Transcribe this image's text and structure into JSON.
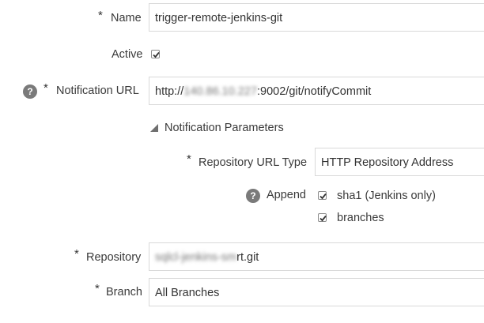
{
  "form": {
    "name": {
      "label": "Name",
      "required_mark": "*",
      "value": "trigger-remote-jenkins-git"
    },
    "active": {
      "label": "Active",
      "checked": true
    },
    "notification_url": {
      "label": "Notification URL",
      "required_mark": "*",
      "value_obscured": "140.86.10.227",
      "value_tail": ":9002/git/notifyCommit",
      "value_prefix": "http://",
      "help_icon": "question-circle-icon",
      "help_glyph": "?"
    },
    "notification_parameters": {
      "label": "Notification Parameters",
      "expander_icon": "triangle-down-icon"
    },
    "repository_url_type": {
      "label": "Repository URL Type",
      "required_mark": "*",
      "value": "HTTP Repository Address"
    },
    "append": {
      "label": "Append",
      "help_icon": "question-circle-icon",
      "help_glyph": "?",
      "options": [
        {
          "label": "sha1 (Jenkins only)",
          "checked": true
        },
        {
          "label": "branches",
          "checked": true
        }
      ]
    },
    "repository": {
      "label": "Repository",
      "required_mark": "*",
      "value_obscured": "sqlcl-jenkins-sm",
      "value_tail": "rt.git"
    },
    "branch": {
      "label": "Branch",
      "required_mark": "*",
      "value": "All Branches"
    }
  },
  "colors": {
    "field_border": "#d9d9d9",
    "label_text": "#3a3a3a",
    "help_icon_bg": "#7a7a7a"
  }
}
